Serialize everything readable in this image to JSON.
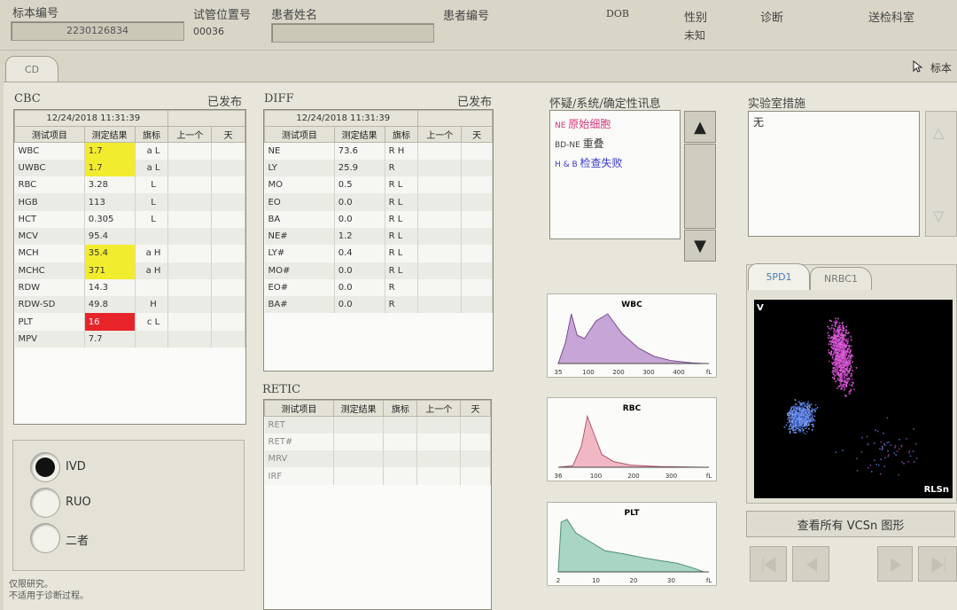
{
  "header": {
    "labels": [
      "标本编号",
      "试管位置号",
      "患者姓名",
      "患者编号",
      "DOB",
      "性别",
      "诊断",
      "送检科室"
    ],
    "sample_no": "2230126834",
    "tube_pos": "00036",
    "patient_name": "",
    "sex": "未知"
  },
  "tabs": {
    "cd": "CD",
    "sample_link": "标本"
  },
  "cbc": {
    "title": "CBC",
    "status": "已发布",
    "timestamp": "12/24/2018  11:31:39",
    "columns": [
      "测试项目",
      "测定结果",
      "旗标",
      "上一个",
      "天"
    ],
    "rows": [
      {
        "item": "WBC",
        "result": "1.7",
        "flag": "a L",
        "hl": "yellow"
      },
      {
        "item": "UWBC",
        "result": "1.7",
        "flag": "a L",
        "hl": "yellow"
      },
      {
        "item": "RBC",
        "result": "3.28",
        "flag": "L",
        "hl": ""
      },
      {
        "item": "HGB",
        "result": "113",
        "flag": "L",
        "hl": ""
      },
      {
        "item": "HCT",
        "result": "0.305",
        "flag": "L",
        "hl": ""
      },
      {
        "item": "MCV",
        "result": "95.4",
        "flag": "",
        "hl": ""
      },
      {
        "item": "MCH",
        "result": "35.4",
        "flag": "a H",
        "hl": "yellow"
      },
      {
        "item": "MCHC",
        "result": "371",
        "flag": "a H",
        "hl": "yellow"
      },
      {
        "item": "RDW",
        "result": "14.3",
        "flag": "",
        "hl": ""
      },
      {
        "item": "RDW-SD",
        "result": "49.8",
        "flag": "H",
        "hl": ""
      },
      {
        "item": "PLT",
        "result": "16",
        "flag": "c L",
        "hl": "red"
      },
      {
        "item": "MPV",
        "result": "7.7",
        "flag": "",
        "hl": ""
      }
    ]
  },
  "diff": {
    "title": "DIFF",
    "status": "已发布",
    "timestamp": "12/24/2018  11:31:39",
    "columns": [
      "测试项目",
      "测定结果",
      "旗标",
      "上一个",
      "天"
    ],
    "rows": [
      {
        "item": "NE",
        "result": "73.6",
        "flag": "R  H"
      },
      {
        "item": "LY",
        "result": "25.9",
        "flag": "R"
      },
      {
        "item": "MO",
        "result": "0.5",
        "flag": "R  L"
      },
      {
        "item": "EO",
        "result": "0.0",
        "flag": "R  L"
      },
      {
        "item": "BA",
        "result": "0.0",
        "flag": "R  L"
      },
      {
        "item": "NE#",
        "result": "1.2",
        "flag": "R  L"
      },
      {
        "item": "LY#",
        "result": "0.4",
        "flag": "R  L"
      },
      {
        "item": "MO#",
        "result": "0.0",
        "flag": "R  L"
      },
      {
        "item": "EO#",
        "result": "0.0",
        "flag": "R"
      },
      {
        "item": "BA#",
        "result": "0.0",
        "flag": "R"
      }
    ]
  },
  "retic": {
    "title": "RETIC",
    "columns": [
      "测试项目",
      "测定结果",
      "旗标",
      "上一个",
      "天"
    ],
    "rows": [
      "RET",
      "RET#",
      "MRV",
      "IRF"
    ]
  },
  "flags": {
    "title": "怀疑/系统/确定性讯息",
    "items": [
      {
        "code": "NE",
        "text": "原始细胞",
        "color": "#d43a7a"
      },
      {
        "code": "BD-NE",
        "text": "重叠",
        "color": "#444444"
      },
      {
        "code": "H & B",
        "text": "检查失败",
        "color": "#3a3ad4"
      }
    ]
  },
  "lab": {
    "title": "实验室措施",
    "text": "无"
  },
  "mode": {
    "options": [
      {
        "label": "IVD",
        "selected": true
      },
      {
        "label": "RUO",
        "selected": false
      },
      {
        "label": "二者",
        "selected": false
      }
    ],
    "note_line1": "仅限研究。",
    "note_line2": "不适用于诊断过程。"
  },
  "histograms": [
    {
      "title": "WBC",
      "ticks": [
        "35",
        "100",
        "200",
        "300",
        "400",
        "fL"
      ],
      "color": "#c7a5d6",
      "stroke": "#7a4e92"
    },
    {
      "title": "RBC",
      "ticks": [
        "36",
        "100",
        "200",
        "300",
        "fL"
      ],
      "color": "#f0b8c4",
      "stroke": "#b5566d"
    },
    {
      "title": "PLT",
      "ticks": [
        "2",
        "10",
        "20",
        "30",
        "fL"
      ],
      "color": "#a9d6c4",
      "stroke": "#4e8e76"
    }
  ],
  "scatter": {
    "tabs": [
      "5PD1",
      "NRBC1"
    ],
    "y_label": "V",
    "x_label": "RLSn",
    "view_all_button": "查看所有 VCSn 图形"
  }
}
